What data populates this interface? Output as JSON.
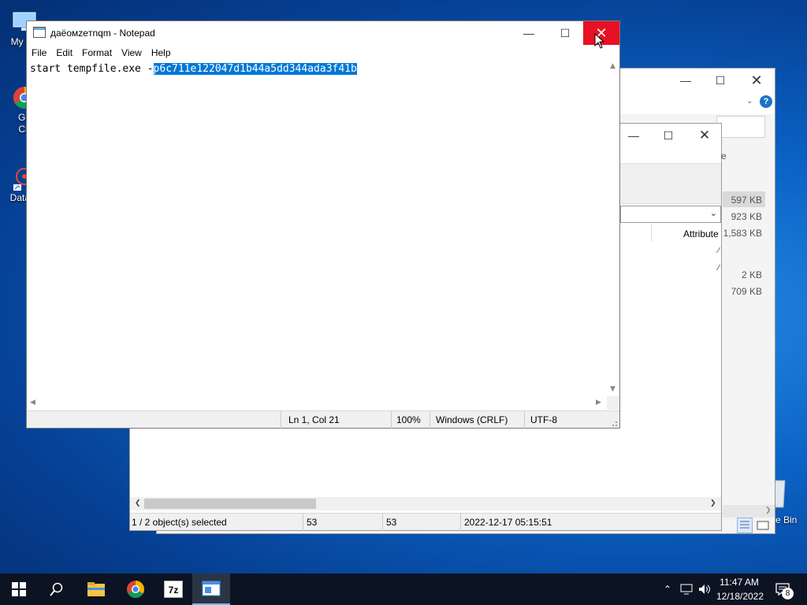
{
  "desktop": {
    "icons": [
      {
        "label": "My Co",
        "icon": "computer-icon"
      },
      {
        "label": "Go\nCh",
        "icon": "chrome-shortcut-icon"
      },
      {
        "label": "DataW",
        "icon": "datawatch-shortcut-icon"
      }
    ],
    "recycle_bin_label": "e Bin"
  },
  "back_window": {
    "sizes": [
      "597 KB",
      "923 KB",
      "1,583 KB",
      "2 KB",
      "709 KB"
    ]
  },
  "mid_window": {
    "partial_label": "e",
    "column_header": "Attribute",
    "status": {
      "selected": "1 / 2 object(s) selected",
      "size1": "53",
      "size2": "53",
      "date": "2022-12-17 05:15:51"
    }
  },
  "notepad": {
    "title": "даёомzeтnqm - Notepad",
    "menu": [
      "File",
      "Edit",
      "Format",
      "View",
      "Help"
    ],
    "text_before": "start tempfile.exe -",
    "text_selected": "p6c711e122047d1b44a5dd344ada3f41b",
    "status": {
      "position": "Ln 1, Col 21",
      "zoom": "100%",
      "line_ending": "Windows (CRLF)",
      "encoding": "UTF-8"
    }
  },
  "taskbar": {
    "time": "11:47 AM",
    "date": "12/18/2022",
    "notification_count": "8",
    "apps": [
      "file-explorer-icon",
      "chrome-icon",
      "7zip-icon",
      "notepad-active-icon"
    ]
  },
  "colors": {
    "close_red": "#e81123",
    "selection_blue": "#0078d7",
    "taskbar": "#0c1322"
  }
}
